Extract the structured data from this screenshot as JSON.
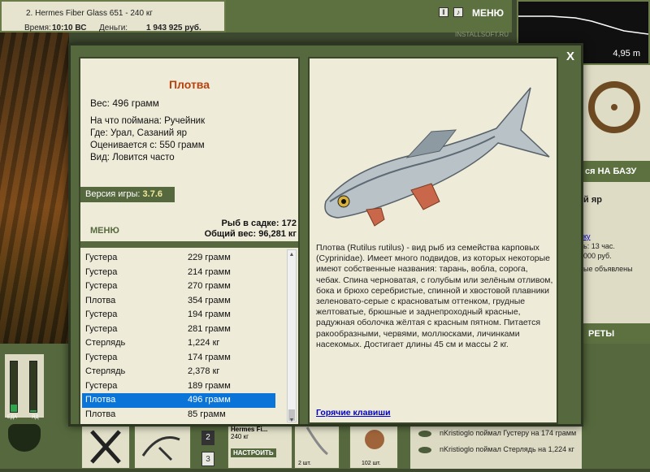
{
  "hud": {
    "rod": "2. Hermes Fiber Glass 651 - 240 кг",
    "time_label": "Время:",
    "time_value": "10:10 ВС",
    "money_label": "Деньги:",
    "money_value": "1 943 925 руб.",
    "menu_label": "МЕНЮ",
    "depth_value": "4,95 m",
    "watermark": "INSTALLSOFT.RU"
  },
  "right_panel": {
    "base_button": "ся НА БАЗУ",
    "location": "й яр",
    "lines": [
      "ку",
      "ь: 13 час.",
      "000 руб.",
      "ые объявлены"
    ],
    "secrets": "РЕТЫ"
  },
  "gauges": {
    "labels": [
      "ЕДА",
      "ЯД"
    ],
    "levels": [
      0.15,
      0.04
    ]
  },
  "bottom": {
    "slot_numbers": [
      "2",
      "3"
    ],
    "reel": "Hermes Fi...",
    "reel_weight": "240 кг",
    "setup_button": "НАСТРОИТЬ",
    "counts": [
      "2 шт.",
      "102 шт."
    ]
  },
  "feed": [
    "nKristioglo поймал Густеру на 174 грамм",
    "nKristioglo поймал Стерлядь на 1,224 кг"
  ],
  "fish": {
    "name": "Плотва",
    "weight": "Вес: 496 грамм",
    "bait": "На что поймана: Ручейник",
    "place": "Где: Урал, Сазаний яр",
    "valued": "Оценивается с: 550 грамм",
    "kind": "Вид: Ловится часто"
  },
  "version": {
    "label": "Версия игры:",
    "value": "3.7.6"
  },
  "menu_button": "МЕНЮ",
  "cage": {
    "count": "Рыб в садке: 172",
    "total": "Общий вес: 96,281 кг"
  },
  "catch_list": [
    {
      "name": "Густера",
      "weight": "229 грамм"
    },
    {
      "name": "Густера",
      "weight": "214 грамм"
    },
    {
      "name": "Густера",
      "weight": "270 грамм"
    },
    {
      "name": "Плотва",
      "weight": "354 грамм"
    },
    {
      "name": "Густера",
      "weight": "194 грамм"
    },
    {
      "name": "Густера",
      "weight": "281 грамм"
    },
    {
      "name": "Стерлядь",
      "weight": "1,224 кг"
    },
    {
      "name": "Густера",
      "weight": "174 грамм"
    },
    {
      "name": "Стерлядь",
      "weight": "2,378 кг"
    },
    {
      "name": "Густера",
      "weight": "189 грамм"
    },
    {
      "name": "Плотва",
      "weight": "496 грамм",
      "selected": true
    },
    {
      "name": "Плотва",
      "weight": "85 грамм"
    }
  ],
  "description": "Плотва (Rutilus rutilus) - вид рыб из семейства карповых (Cyprinidae). Имеет много подвидов, из которых некоторые имеют собственные названия: тарань, вобла, сорога, чебак. Спина черноватая, с голубым или зелёным отливом, бока и брюхо серебристые, спинной и хвостовой плавники зеленовато-серые с красноватым оттенком, грудные желтоватые, брюшные и заднепроходный красные, радужная оболочка жёлтая с красным пятном. Питается ракообразными, червями, моллюсками, личинками насекомых. Достигает длины 45 см и массы 2 кг.",
  "hotkeys_link": "Горячие клавиши",
  "close_icon": "close-icon",
  "colors": {
    "frame": "#56693e",
    "panel": "#eeebd9",
    "fish_name": "#b8410e",
    "selected": "#0a74d8"
  }
}
